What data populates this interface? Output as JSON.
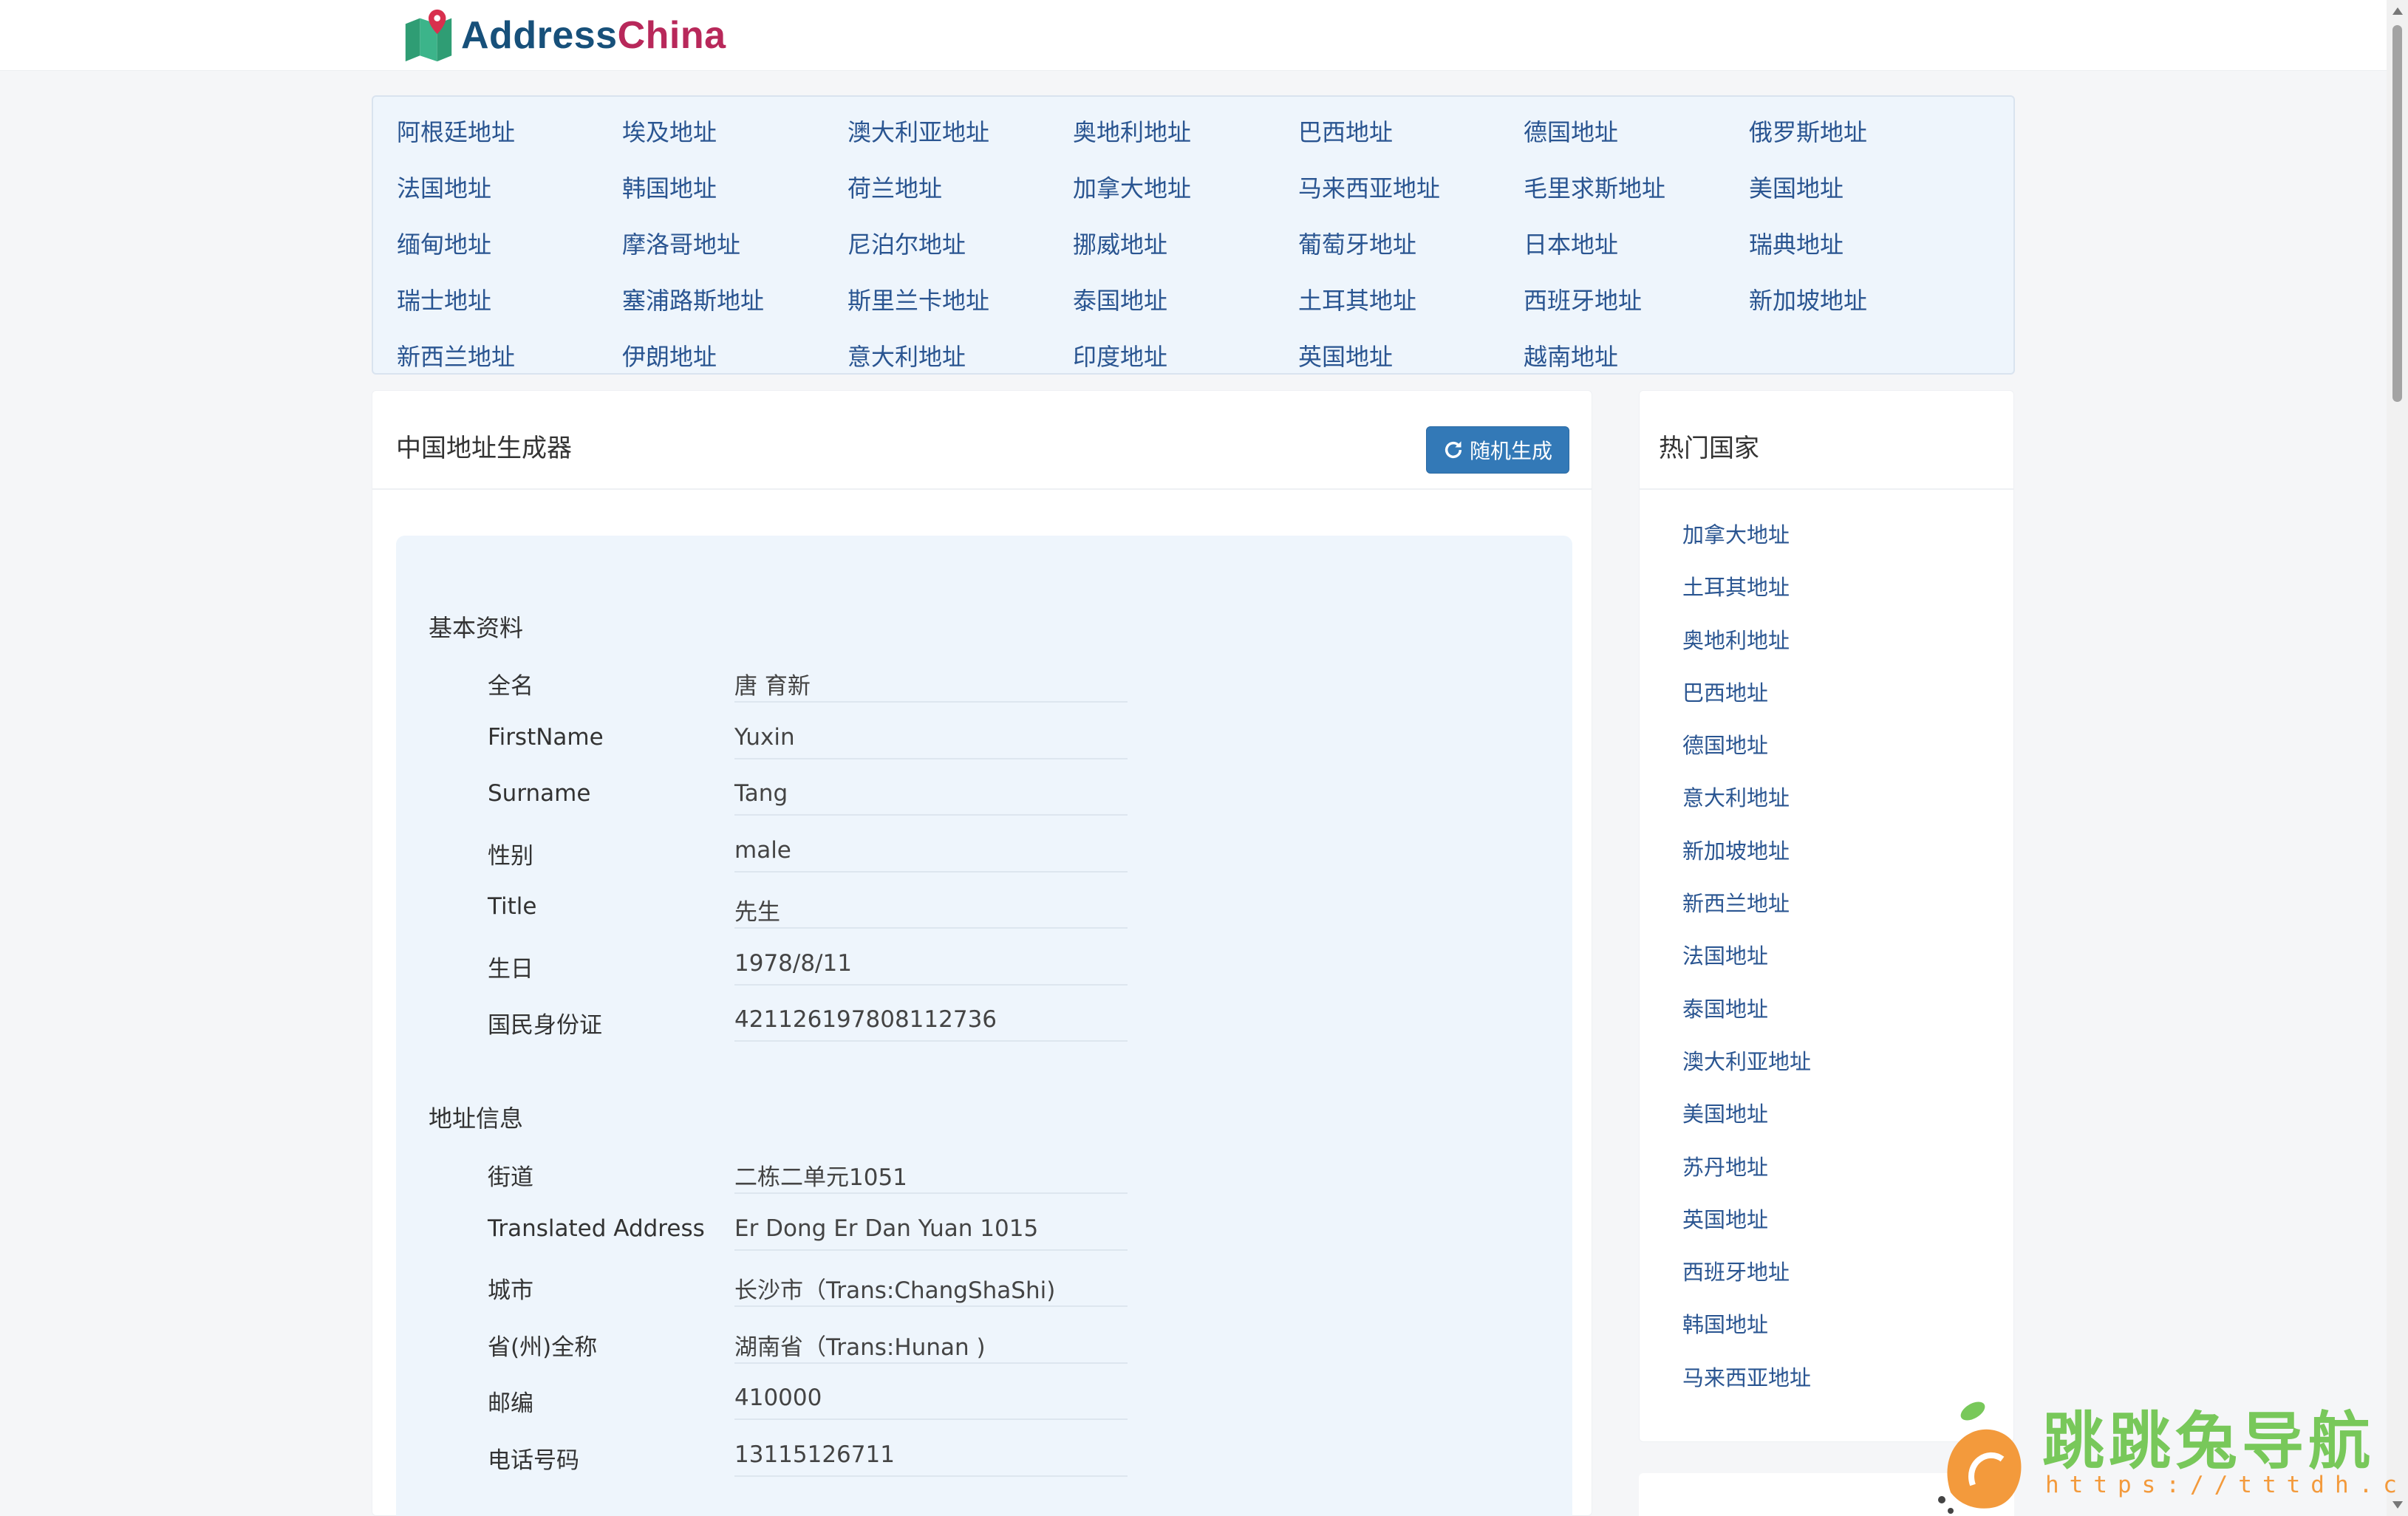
{
  "header": {
    "logo_text_a": "Address",
    "logo_text_b": "China"
  },
  "countries": [
    "阿根廷地址",
    "埃及地址",
    "澳大利亚地址",
    "奥地利地址",
    "巴西地址",
    "德国地址",
    "俄罗斯地址",
    "法国地址",
    "韩国地址",
    "荷兰地址",
    "加拿大地址",
    "马来西亚地址",
    "毛里求斯地址",
    "美国地址",
    "缅甸地址",
    "摩洛哥地址",
    "尼泊尔地址",
    "挪威地址",
    "葡萄牙地址",
    "日本地址",
    "瑞典地址",
    "瑞士地址",
    "塞浦路斯地址",
    "斯里兰卡地址",
    "泰国地址",
    "土耳其地址",
    "西班牙地址",
    "新加坡地址",
    "新西兰地址",
    "伊朗地址",
    "意大利地址",
    "印度地址",
    "英国地址",
    "越南地址"
  ],
  "main": {
    "title": "中国地址生成器",
    "button_label": "随机生成",
    "sections": {
      "basic_title": "基本资料",
      "address_title": "地址信息"
    },
    "basic": [
      {
        "label": "全名",
        "value": "唐  育新"
      },
      {
        "label": "FirstName",
        "value": "Yuxin"
      },
      {
        "label": "Surname",
        "value": "Tang"
      },
      {
        "label": "性别",
        "value": "male"
      },
      {
        "label": "Title",
        "value": "先生"
      },
      {
        "label": "生日",
        "value": "1978/8/11"
      },
      {
        "label": "国民身份证",
        "value": "421126197808112736"
      }
    ],
    "address": [
      {
        "label": "街道",
        "value": "二栋二单元1051"
      },
      {
        "label": "Translated Address",
        "value": "Er Dong Er Dan Yuan 1015"
      },
      {
        "label": "城市",
        "value": "长沙市（Trans:ChangShaShi)"
      },
      {
        "label": "省(州)全称",
        "value": "湖南省（Trans:Hunan )"
      },
      {
        "label": "邮编",
        "value": "410000"
      },
      {
        "label": "电话号码",
        "value": "13115126711"
      }
    ]
  },
  "sidebar": {
    "title": "热门国家",
    "items": [
      "加拿大地址",
      "土耳其地址",
      "奥地利地址",
      "巴西地址",
      "德国地址",
      "意大利地址",
      "新加坡地址",
      "新西兰地址",
      "法国地址",
      "泰国地址",
      "澳大利亚地址",
      "美国地址",
      "苏丹地址",
      "英国地址",
      "西班牙地址",
      "韩国地址",
      "马来西亚地址"
    ]
  },
  "watermark": {
    "text": "跳跳兔导航",
    "url": "https://tttdh.com"
  },
  "colors": {
    "link": "#2a5591",
    "button": "#3379b7",
    "panel_bg": "#eef5fc",
    "watermark_green": "#78c85a",
    "watermark_orange": "#f39a3c"
  }
}
